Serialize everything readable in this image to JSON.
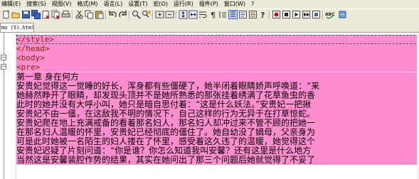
{
  "menu": [
    "编辑(E)",
    "搜索(S)",
    "视图(V)",
    "格式(M)",
    "语言(L)",
    "设置(T)",
    "宏(O)",
    "运行(R)",
    "插件(P)",
    "窗口(W)",
    "?"
  ],
  "tab": {
    "label": "mo (5).html"
  },
  "editor": {
    "lines": [
      {
        "text": "</style>",
        "kind": "tag"
      },
      {
        "text": "</head>",
        "kind": "tag"
      },
      {
        "text": "<body>",
        "kind": "tag"
      },
      {
        "text": "<pre>",
        "kind": "tag"
      },
      {
        "text": "第一章  身在何方",
        "kind": "txt"
      },
      {
        "text": "    安贵妃觉得这一觉睡的好长，浑身都有些僵硬了，她半闭着眼睛娇声呼唤道：“来",
        "kind": "txt"
      },
      {
        "text": "    她赫然睁开了眼睛，却发现头顶并不是她所熟悉的那张挂着绣满了花草鱼虫的香",
        "kind": "txt"
      },
      {
        "text": "    此时的她并没有大呼小叫，她只是暗自思付着：“这是什么妖法。”安贵妃一把揪",
        "kind": "txt"
      },
      {
        "text": "    安贵妃不由一僵，在这敌我不明的情况下，自己这样的行为无异于在打草惊蛇。",
        "kind": "txt"
      },
      {
        "text": "    安贵妃爬在地上充满戒备的看着那名妇人，那名妇人却冲过来不管不顾的把她一",
        "kind": "txt"
      },
      {
        "text": "    在那名妇人温暖的怀里，安贵妃已经彻底的僵住了。她自幼没了嫡母，父亲身为",
        "kind": "txt"
      },
      {
        "text": "    可是此时她被一名陌生的妇人搂在了怀里，感受着这久违了的温暖，她觉得这个",
        "kind": "txt"
      },
      {
        "text": "    安贵妃迟疑了片刻问道：“你是谁？你怎么知道我叫安馨？还有这里是什么地方",
        "kind": "txt"
      },
      {
        "text": "    当然这是安馨装腔作势的结果，其实在她问出了那三个问题后她就觉得了不妥了",
        "kind": "txt"
      }
    ]
  }
}
